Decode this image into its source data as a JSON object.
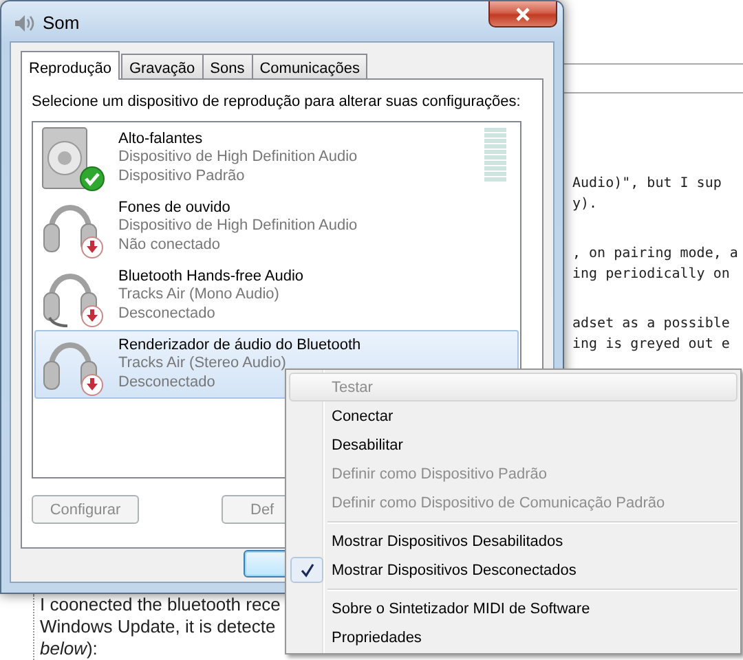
{
  "background_page": {
    "paragraphs": [
      {
        "lines": [
          "Audio)\", but I sup",
          "y)."
        ]
      },
      {
        "lines": [
          ", on pairing mode, a",
          "ing periodically on"
        ]
      },
      {
        "lines": [
          "adset as a possible",
          "ing is greyed out e"
        ]
      }
    ],
    "bottom_lines": [
      "I coonected the bluetooth rece",
      "Windows Update, it is detecte",
      "*below*):"
    ]
  },
  "window": {
    "title": "Som"
  },
  "tabs": [
    {
      "label": "Reprodução",
      "selected": true
    },
    {
      "label": "Gravação",
      "selected": false
    },
    {
      "label": "Sons",
      "selected": false
    },
    {
      "label": "Comunicações",
      "selected": false
    }
  ],
  "instruction": "Selecione um dispositivo de reprodução para alterar suas configurações:",
  "devices": [
    {
      "name": "Alto-falantes",
      "line_1": "Dispositivo de High Definition Audio",
      "line_2": "Dispositivo Padrão",
      "kind": "speaker",
      "default": true,
      "connected": true,
      "meter": true,
      "selected": false
    },
    {
      "name": "Fones de ouvido",
      "line_1": "Dispositivo de High Definition Audio",
      "line_2": "Não conectado",
      "kind": "headphones",
      "default": false,
      "connected": false,
      "meter": false,
      "selected": false
    },
    {
      "name": "Bluetooth Hands-free Audio",
      "line_1": "Tracks Air (Mono Audio)",
      "line_2": "Desconectado",
      "kind": "headset",
      "default": false,
      "connected": false,
      "meter": false,
      "selected": false
    },
    {
      "name": "Renderizador de áudio do Bluetooth",
      "line_1": "Tracks Air (Stereo Audio)",
      "line_2": "Desconectado",
      "kind": "headphones",
      "default": false,
      "connected": false,
      "meter": false,
      "selected": true
    }
  ],
  "buttons": [
    {
      "label": "Configurar",
      "disabled": true
    },
    {
      "label": "Def",
      "disabled": true
    }
  ],
  "context_menu": {
    "items": [
      {
        "kind": "item",
        "label": "Testar",
        "disabled": true,
        "checked": false,
        "highlighted": true
      },
      {
        "kind": "item",
        "label": "Conectar",
        "disabled": false,
        "checked": false,
        "highlighted": false
      },
      {
        "kind": "item",
        "label": "Desabilitar",
        "disabled": false,
        "checked": false,
        "highlighted": false
      },
      {
        "kind": "item",
        "label": "Definir como Dispositivo Padrão",
        "disabled": true,
        "checked": false,
        "highlighted": false
      },
      {
        "kind": "item",
        "label": "Definir como Dispositivo de Comunicação Padrão",
        "disabled": true,
        "checked": false,
        "highlighted": false
      },
      {
        "kind": "separator"
      },
      {
        "kind": "item",
        "label": "Mostrar Dispositivos Desabilitados",
        "disabled": false,
        "checked": false,
        "highlighted": false
      },
      {
        "kind": "item",
        "label": "Mostrar Dispositivos Desconectados",
        "disabled": false,
        "checked": true,
        "highlighted": false
      },
      {
        "kind": "separator"
      },
      {
        "kind": "item",
        "label": "Sobre o Sintetizador MIDI de Software",
        "disabled": false,
        "checked": false,
        "highlighted": false
      },
      {
        "kind": "item",
        "label": "Propriedades",
        "disabled": false,
        "checked": false,
        "highlighted": false
      }
    ]
  }
}
